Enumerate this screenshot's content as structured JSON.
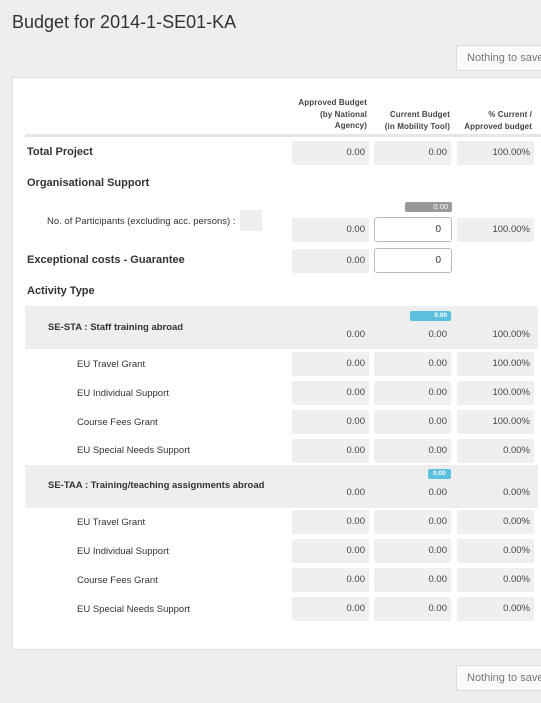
{
  "page": {
    "title": "Budget for 2014-1-SE01-KA",
    "save_button_label": "Nothing to save"
  },
  "table": {
    "headers": {
      "approved": [
        "Approved Budget",
        "(by National",
        "Agency)"
      ],
      "current": [
        "Current Budget",
        "(in Mobility Tool)"
      ],
      "percent": [
        "% Current /",
        "Approved budget"
      ]
    },
    "total_project": {
      "label": "Total Project",
      "approved": "0.00",
      "current": "0.00",
      "percent": "100.00%"
    },
    "organisational_support": {
      "label": "Organisational Support",
      "participants_label": "No. of Participants (excluding acc. persons) :",
      "badge": "0.00",
      "approved": "0.00",
      "current_input": "0",
      "percent": "100.00%"
    },
    "exceptional_costs": {
      "label": "Exceptional costs - Guarantee",
      "approved": "0.00",
      "current_input": "0"
    },
    "activity_type_label": "Activity Type",
    "activities": [
      {
        "label": "SE-STA : Staff training abroad",
        "badge": "0.00",
        "approved": "0.00",
        "current": "0.00",
        "percent": "100.00%",
        "items": [
          {
            "label": "EU Travel Grant",
            "approved": "0.00",
            "current": "0.00",
            "percent": "100.00%"
          },
          {
            "label": "EU Individual Support",
            "approved": "0.00",
            "current": "0.00",
            "percent": "100.00%"
          },
          {
            "label": "Course Fees Grant",
            "approved": "0.00",
            "current": "0.00",
            "percent": "100.00%"
          },
          {
            "label": "EU Special Needs Support",
            "approved": "0.00",
            "current": "0.00",
            "percent": "0.00%"
          }
        ]
      },
      {
        "label": "SE-TAA : Training/teaching assignments abroad",
        "badge": "0.00",
        "approved": "0.00",
        "current": "0.00",
        "percent": "0.00%",
        "items": [
          {
            "label": "EU Travel Grant",
            "approved": "0.00",
            "current": "0.00",
            "percent": "0.00%"
          },
          {
            "label": "EU Individual Support",
            "approved": "0.00",
            "current": "0.00",
            "percent": "0.00%"
          },
          {
            "label": "Course Fees Grant",
            "approved": "0.00",
            "current": "0.00",
            "percent": "0.00%"
          },
          {
            "label": "EU Special Needs Support",
            "approved": "0.00",
            "current": "0.00",
            "percent": "0.00%"
          }
        ]
      }
    ]
  }
}
